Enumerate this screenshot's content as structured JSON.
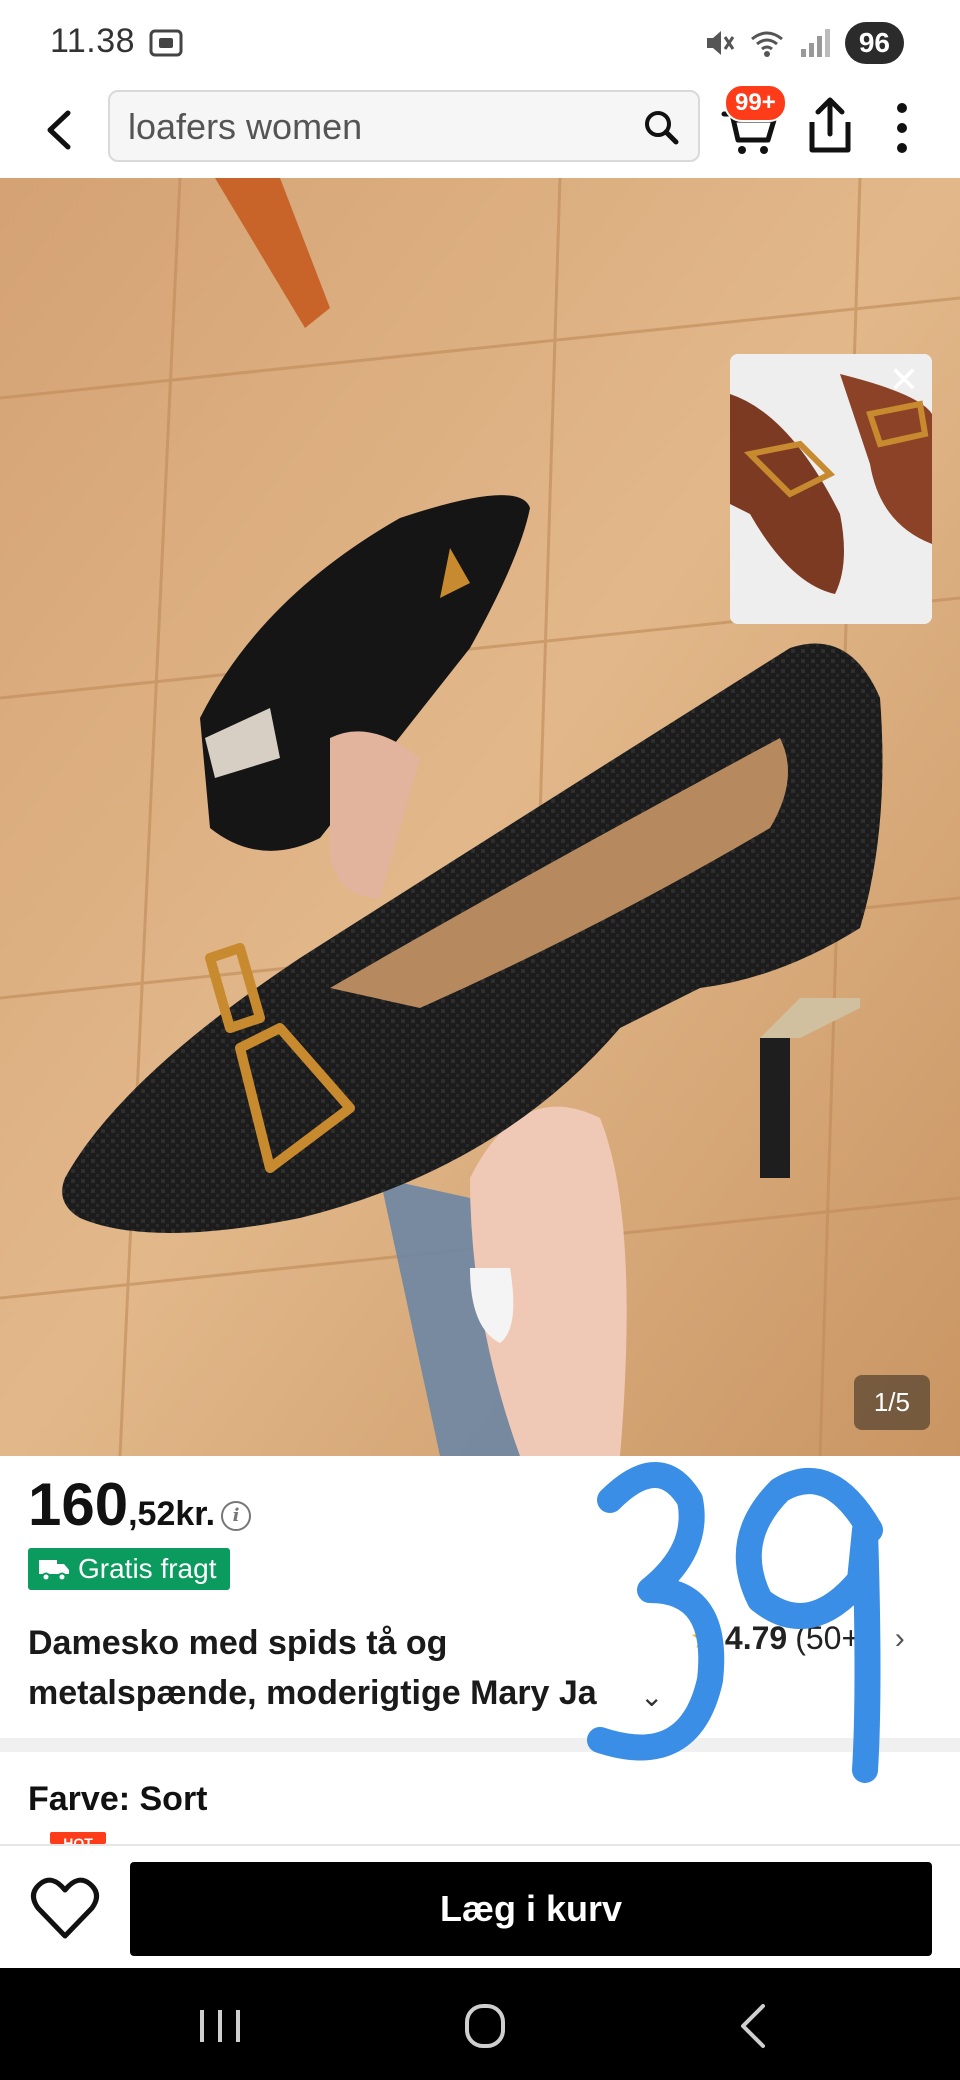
{
  "status_bar": {
    "time": "11.38",
    "battery": "96"
  },
  "header": {
    "search_text": "loafers women",
    "cart_badge": "99+"
  },
  "product_image": {
    "counter": "1/5"
  },
  "product": {
    "price_main": "160",
    "price_sub": ",52kr.",
    "shipping_label": "Gratis fragt",
    "title_line1": "Damesko med spids tå og",
    "title_line2": "metalspænde, moderigtige Mary Ja",
    "rating_value": "4.79",
    "rating_count": "(50",
    "rating_count_tail": "+)",
    "color_label": "Farve: Sort",
    "hot_tag": "HOT"
  },
  "action_bar": {
    "add_to_cart_label": "Læg i kurv"
  },
  "annotation": {
    "handwritten_text": "39",
    "color": "#3a8ee6"
  },
  "colors": {
    "accent_red": "#fe3c19",
    "shipping_green": "#0c9b5e",
    "primary_button": "#000000",
    "star": "#f5b800"
  },
  "icons": {
    "back": "back-arrow-icon",
    "search": "search-icon",
    "cart": "cart-icon",
    "share": "share-icon",
    "more": "more-vertical-icon",
    "close": "close-icon",
    "truck": "truck-icon",
    "info": "info-icon",
    "star": "star-icon",
    "wishlist": "heart-icon"
  }
}
